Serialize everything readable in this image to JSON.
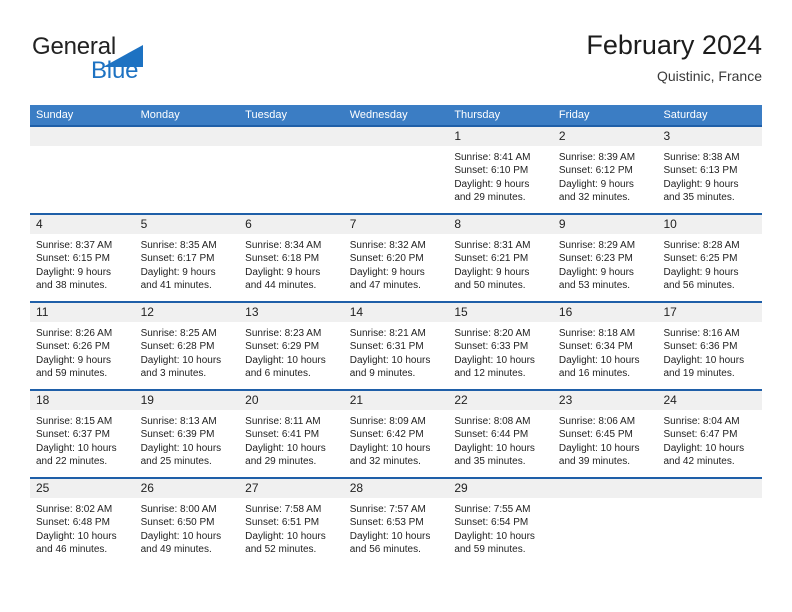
{
  "brand": {
    "name_part1": "General",
    "name_part2": "Blue",
    "accent_color": "#1d72c2",
    "triangle_icon": "triangle-icon"
  },
  "header": {
    "title": "February 2024",
    "subtitle": "Quistinic, France"
  },
  "theme": {
    "header_bar_color": "#3b7dc4",
    "row_border_color": "#1f5fa8",
    "daynum_band_color": "#f0f0f0",
    "text_color": "#1f1f1f"
  },
  "weekdays": [
    "Sunday",
    "Monday",
    "Tuesday",
    "Wednesday",
    "Thursday",
    "Friday",
    "Saturday"
  ],
  "weeks": [
    [
      {
        "day": "",
        "lines": []
      },
      {
        "day": "",
        "lines": []
      },
      {
        "day": "",
        "lines": []
      },
      {
        "day": "",
        "lines": []
      },
      {
        "day": "1",
        "lines": [
          "Sunrise: 8:41 AM",
          "Sunset: 6:10 PM",
          "Daylight: 9 hours",
          "and 29 minutes."
        ]
      },
      {
        "day": "2",
        "lines": [
          "Sunrise: 8:39 AM",
          "Sunset: 6:12 PM",
          "Daylight: 9 hours",
          "and 32 minutes."
        ]
      },
      {
        "day": "3",
        "lines": [
          "Sunrise: 8:38 AM",
          "Sunset: 6:13 PM",
          "Daylight: 9 hours",
          "and 35 minutes."
        ]
      }
    ],
    [
      {
        "day": "4",
        "lines": [
          "Sunrise: 8:37 AM",
          "Sunset: 6:15 PM",
          "Daylight: 9 hours",
          "and 38 minutes."
        ]
      },
      {
        "day": "5",
        "lines": [
          "Sunrise: 8:35 AM",
          "Sunset: 6:17 PM",
          "Daylight: 9 hours",
          "and 41 minutes."
        ]
      },
      {
        "day": "6",
        "lines": [
          "Sunrise: 8:34 AM",
          "Sunset: 6:18 PM",
          "Daylight: 9 hours",
          "and 44 minutes."
        ]
      },
      {
        "day": "7",
        "lines": [
          "Sunrise: 8:32 AM",
          "Sunset: 6:20 PM",
          "Daylight: 9 hours",
          "and 47 minutes."
        ]
      },
      {
        "day": "8",
        "lines": [
          "Sunrise: 8:31 AM",
          "Sunset: 6:21 PM",
          "Daylight: 9 hours",
          "and 50 minutes."
        ]
      },
      {
        "day": "9",
        "lines": [
          "Sunrise: 8:29 AM",
          "Sunset: 6:23 PM",
          "Daylight: 9 hours",
          "and 53 minutes."
        ]
      },
      {
        "day": "10",
        "lines": [
          "Sunrise: 8:28 AM",
          "Sunset: 6:25 PM",
          "Daylight: 9 hours",
          "and 56 minutes."
        ]
      }
    ],
    [
      {
        "day": "11",
        "lines": [
          "Sunrise: 8:26 AM",
          "Sunset: 6:26 PM",
          "Daylight: 9 hours",
          "and 59 minutes."
        ]
      },
      {
        "day": "12",
        "lines": [
          "Sunrise: 8:25 AM",
          "Sunset: 6:28 PM",
          "Daylight: 10 hours",
          "and 3 minutes."
        ]
      },
      {
        "day": "13",
        "lines": [
          "Sunrise: 8:23 AM",
          "Sunset: 6:29 PM",
          "Daylight: 10 hours",
          "and 6 minutes."
        ]
      },
      {
        "day": "14",
        "lines": [
          "Sunrise: 8:21 AM",
          "Sunset: 6:31 PM",
          "Daylight: 10 hours",
          "and 9 minutes."
        ]
      },
      {
        "day": "15",
        "lines": [
          "Sunrise: 8:20 AM",
          "Sunset: 6:33 PM",
          "Daylight: 10 hours",
          "and 12 minutes."
        ]
      },
      {
        "day": "16",
        "lines": [
          "Sunrise: 8:18 AM",
          "Sunset: 6:34 PM",
          "Daylight: 10 hours",
          "and 16 minutes."
        ]
      },
      {
        "day": "17",
        "lines": [
          "Sunrise: 8:16 AM",
          "Sunset: 6:36 PM",
          "Daylight: 10 hours",
          "and 19 minutes."
        ]
      }
    ],
    [
      {
        "day": "18",
        "lines": [
          "Sunrise: 8:15 AM",
          "Sunset: 6:37 PM",
          "Daylight: 10 hours",
          "and 22 minutes."
        ]
      },
      {
        "day": "19",
        "lines": [
          "Sunrise: 8:13 AM",
          "Sunset: 6:39 PM",
          "Daylight: 10 hours",
          "and 25 minutes."
        ]
      },
      {
        "day": "20",
        "lines": [
          "Sunrise: 8:11 AM",
          "Sunset: 6:41 PM",
          "Daylight: 10 hours",
          "and 29 minutes."
        ]
      },
      {
        "day": "21",
        "lines": [
          "Sunrise: 8:09 AM",
          "Sunset: 6:42 PM",
          "Daylight: 10 hours",
          "and 32 minutes."
        ]
      },
      {
        "day": "22",
        "lines": [
          "Sunrise: 8:08 AM",
          "Sunset: 6:44 PM",
          "Daylight: 10 hours",
          "and 35 minutes."
        ]
      },
      {
        "day": "23",
        "lines": [
          "Sunrise: 8:06 AM",
          "Sunset: 6:45 PM",
          "Daylight: 10 hours",
          "and 39 minutes."
        ]
      },
      {
        "day": "24",
        "lines": [
          "Sunrise: 8:04 AM",
          "Sunset: 6:47 PM",
          "Daylight: 10 hours",
          "and 42 minutes."
        ]
      }
    ],
    [
      {
        "day": "25",
        "lines": [
          "Sunrise: 8:02 AM",
          "Sunset: 6:48 PM",
          "Daylight: 10 hours",
          "and 46 minutes."
        ]
      },
      {
        "day": "26",
        "lines": [
          "Sunrise: 8:00 AM",
          "Sunset: 6:50 PM",
          "Daylight: 10 hours",
          "and 49 minutes."
        ]
      },
      {
        "day": "27",
        "lines": [
          "Sunrise: 7:58 AM",
          "Sunset: 6:51 PM",
          "Daylight: 10 hours",
          "and 52 minutes."
        ]
      },
      {
        "day": "28",
        "lines": [
          "Sunrise: 7:57 AM",
          "Sunset: 6:53 PM",
          "Daylight: 10 hours",
          "and 56 minutes."
        ]
      },
      {
        "day": "29",
        "lines": [
          "Sunrise: 7:55 AM",
          "Sunset: 6:54 PM",
          "Daylight: 10 hours",
          "and 59 minutes."
        ]
      },
      {
        "day": "",
        "lines": []
      },
      {
        "day": "",
        "lines": []
      }
    ]
  ]
}
